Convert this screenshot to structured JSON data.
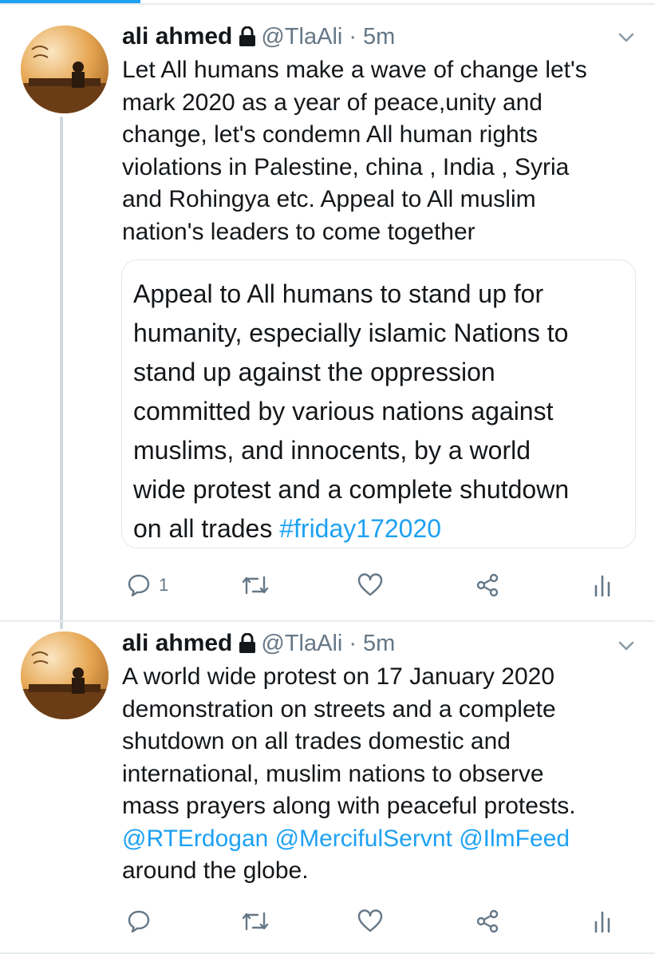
{
  "accent_color": "#1da1f2",
  "tweets": [
    {
      "author_name": "ali ahmed",
      "handle": "@TlaAli",
      "separator": "·",
      "time": "5m",
      "text_lines": [
        "Let All humans make a wave of change let's",
        "mark 2020 as a year of peace,unity and",
        "change, let's condemn All human rights",
        "violations in Palestine, china , India , Syria",
        "and Rohingya etc. Appeal to All muslim",
        "nation's leaders to come together"
      ],
      "quote": {
        "text_lines": [
          "Appeal to All humans to stand up for",
          "humanity, especially islamic Nations to",
          "stand up against the oppression",
          "committed by various nations against",
          "muslims, and innocents, by  a world",
          "wide protest and a complete shutdown"
        ],
        "last_line_prefix": "on all trades ",
        "hashtag": "#friday172020"
      },
      "reply_count": "1",
      "icons": [
        "lock-icon",
        "chevron-down-icon",
        "reply-icon",
        "retweet-icon",
        "like-icon",
        "share-icon",
        "analytics-icon"
      ]
    },
    {
      "author_name": "ali ahmed",
      "handle": "@TlaAli",
      "separator": "·",
      "time": "5m",
      "text_lines": [
        "A world wide protest on 17 January 2020",
        "demonstration on streets and a  complete",
        "shutdown on all trades domestic and",
        "international, muslim nations to observe",
        "mass prayers along with peaceful protests."
      ],
      "mentions": [
        "@RTErdogan",
        "@MercifulServnt",
        "@IlmFeed"
      ],
      "last_line": "around the globe.",
      "icons": [
        "lock-icon",
        "chevron-down-icon",
        "reply-icon",
        "retweet-icon",
        "like-icon",
        "share-icon",
        "analytics-icon"
      ]
    }
  ]
}
